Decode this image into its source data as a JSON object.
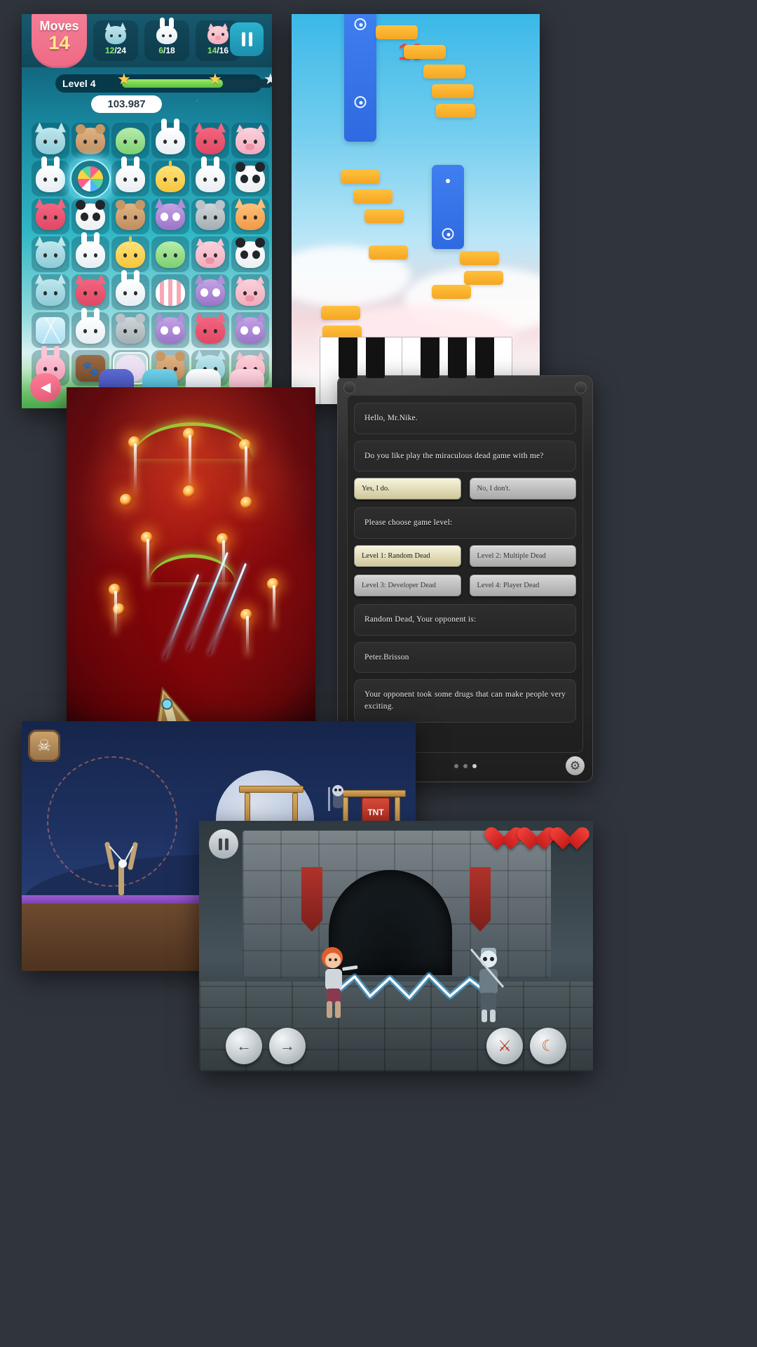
{
  "panels": {
    "match3": {
      "title": "animal-match3-game",
      "moves_label": "Moves",
      "moves_value": "14",
      "goals": [
        {
          "icon": "cat-icon",
          "current": "12",
          "total": "/24",
          "color": "#9fd8e0"
        },
        {
          "icon": "rabbit-icon",
          "current": "6",
          "total": "/18",
          "color": "#f2f6f8"
        },
        {
          "icon": "pig-icon",
          "current": "14",
          "total": "/16",
          "color": "#f7bfc9"
        }
      ],
      "level_label": "Level 4",
      "score": "103.987",
      "pause_icon": "pause-icon",
      "back_icon": "back-arrow-icon",
      "progress_percent": 67,
      "grid": [
        [
          "cat",
          "bear",
          "frog",
          "rabbit",
          "fox",
          "pig"
        ],
        [
          "rabbit",
          "candy",
          "rabbit",
          "chick",
          "rabbit",
          "panda"
        ],
        [
          "fox",
          "panda",
          "bear",
          "owl",
          "koala",
          "tiger"
        ],
        [
          "cat",
          "rabbit",
          "chick",
          "frog",
          "pig",
          "panda"
        ],
        [
          "cat",
          "fox",
          "rabbit",
          "stripe",
          "owl",
          "pig"
        ],
        [
          "ice",
          "rabbit",
          "koala",
          "owl",
          "fox",
          "owl"
        ],
        [
          "pinkrabbit",
          "paw",
          "bubble",
          "bear",
          "cat",
          "pig"
        ]
      ],
      "boosters": [
        "bomb-booster",
        "color-booster",
        "clock-booster",
        "swirl-booster"
      ]
    },
    "piano": {
      "title": "piano-tiles-game",
      "score": "16"
    },
    "shooter": {
      "title": "red-space-shooter-game"
    },
    "dialog": {
      "title": "dead-game-chat-dialog",
      "messages": [
        "Hello,  Mr.Nike.",
        "Do  you  like  play  the  miraculous  dead  game  with  me?",
        "Please  choose  game  level:",
        "Random  Dead,  Your  opponent  is:",
        "Peter.Brisson",
        "Your  opponent  took  some  drugs  that  can  make  people  very  exciting."
      ],
      "answer_buttons": [
        {
          "label": "Yes,  I  do.",
          "style": "gold"
        },
        {
          "label": "No,  I  don't.",
          "style": "grey"
        }
      ],
      "level_buttons": [
        {
          "label": "Level  1:  Random  Dead",
          "style": "gold"
        },
        {
          "label": "Level  2:  Multiple  Dead",
          "style": "grey"
        },
        {
          "label": "Level  3:  Developer  Dead",
          "style": "grey"
        },
        {
          "label": "Level  4:  Player  Dead",
          "style": "grey"
        }
      ],
      "page_dots": 3,
      "active_dot": 2,
      "gear_icon": "gear-icon"
    },
    "slingshot": {
      "title": "slingshot-night-game",
      "tnt_label": "TNT",
      "skull_icon": "skull-icon"
    },
    "knight": {
      "title": "knight-battle-game",
      "pause_icon": "pause-icon",
      "hearts": 3,
      "controls": [
        {
          "icon": "left-arrow-icon"
        },
        {
          "icon": "right-arrow-icon"
        },
        {
          "icon": "sword-icon"
        },
        {
          "icon": "moon-icon"
        }
      ]
    }
  },
  "colors": {
    "background": "#30343c",
    "accent_pink": "#ef6a86",
    "accent_green": "#8ae86a",
    "accent_red": "#e8453c",
    "gold": "#ffcf46"
  }
}
